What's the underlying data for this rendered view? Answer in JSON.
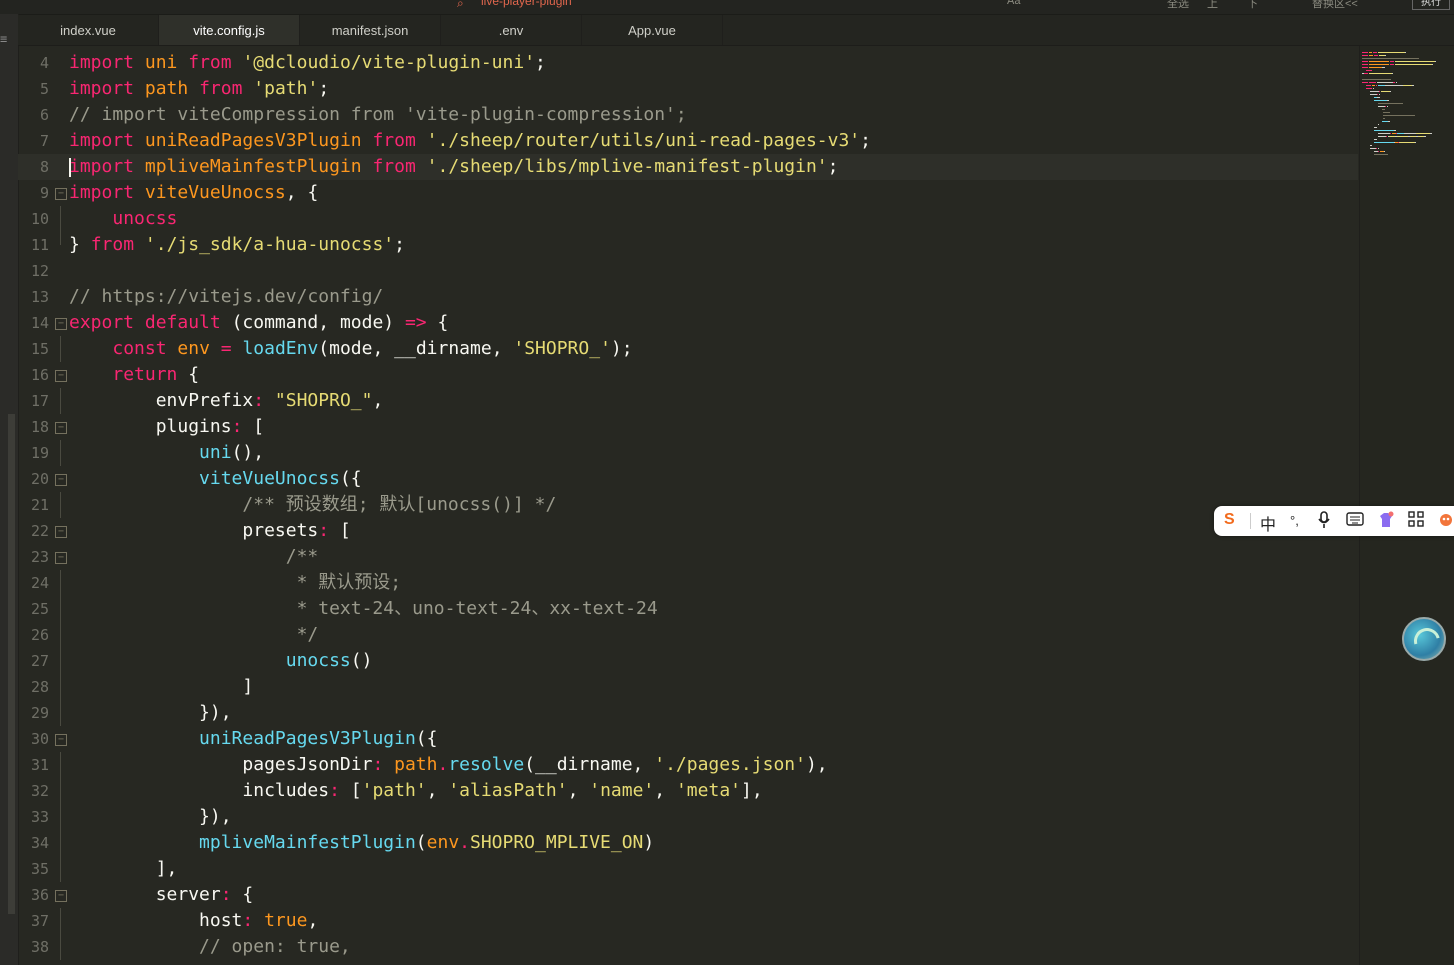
{
  "find_bar": {
    "search_text": "live-player-plugin",
    "controls": [
      "Aa",
      "全选",
      "上",
      "下",
      "替换区<<"
    ],
    "button_label": "执行"
  },
  "tabs": [
    {
      "label": "index.vue",
      "active": false
    },
    {
      "label": "vite.config.js",
      "active": true
    },
    {
      "label": "manifest.json",
      "active": false
    },
    {
      "label": ".env",
      "active": false
    },
    {
      "label": "App.vue",
      "active": false
    }
  ],
  "lines": [
    {
      "n": "4",
      "fold": "",
      "tokens": [
        [
          "kw",
          "import"
        ],
        [
          "pl",
          " "
        ],
        [
          "or",
          "uni"
        ],
        [
          "pl",
          " "
        ],
        [
          "kw",
          "from"
        ],
        [
          "pl",
          " "
        ],
        [
          "st",
          "'@dcloudio/vite-plugin-uni'"
        ],
        [
          "pl",
          ";"
        ]
      ]
    },
    {
      "n": "5",
      "fold": "",
      "tokens": [
        [
          "kw",
          "import"
        ],
        [
          "pl",
          " "
        ],
        [
          "or",
          "path"
        ],
        [
          "pl",
          " "
        ],
        [
          "kw",
          "from"
        ],
        [
          "pl",
          " "
        ],
        [
          "st",
          "'path'"
        ],
        [
          "pl",
          ";"
        ]
      ]
    },
    {
      "n": "6",
      "fold": "",
      "tokens": [
        [
          "cm",
          "// import viteCompression from 'vite-plugin-compression';"
        ]
      ]
    },
    {
      "n": "7",
      "fold": "",
      "tokens": [
        [
          "kw",
          "import"
        ],
        [
          "pl",
          " "
        ],
        [
          "or",
          "uniReadPagesV3Plugin"
        ],
        [
          "pl",
          " "
        ],
        [
          "kw",
          "from"
        ],
        [
          "pl",
          " "
        ],
        [
          "st",
          "'./sheep/router/utils/uni-read-pages-v3'"
        ],
        [
          "pl",
          ";"
        ]
      ]
    },
    {
      "n": "8",
      "fold": "",
      "current": true,
      "tokens": [
        [
          "kw",
          "import"
        ],
        [
          "pl",
          " "
        ],
        [
          "or",
          "mpliveMainfestPlugin"
        ],
        [
          "pl",
          " "
        ],
        [
          "kw",
          "from"
        ],
        [
          "pl",
          " "
        ],
        [
          "st",
          "'./sheep/libs/mplive-manifest-plugin'"
        ],
        [
          "pl",
          ";"
        ]
      ]
    },
    {
      "n": "9",
      "fold": "open",
      "tokens": [
        [
          "kw",
          "import"
        ],
        [
          "pl",
          " "
        ],
        [
          "or",
          "viteVueUnocss"
        ],
        [
          "pl",
          ", {"
        ]
      ]
    },
    {
      "n": "10",
      "fold": "line",
      "tokens": [
        [
          "pl",
          "    "
        ],
        [
          "kw",
          "unocss"
        ]
      ]
    },
    {
      "n": "11",
      "fold": "end",
      "tokens": [
        [
          "pl",
          "} "
        ],
        [
          "kw",
          "from"
        ],
        [
          "pl",
          " "
        ],
        [
          "st",
          "'./js_sdk/a-hua-unocss'"
        ],
        [
          "pl",
          ";"
        ]
      ]
    },
    {
      "n": "12",
      "fold": "",
      "tokens": []
    },
    {
      "n": "13",
      "fold": "",
      "tokens": [
        [
          "cm",
          "// https://vitejs.dev/config/"
        ]
      ]
    },
    {
      "n": "14",
      "fold": "open",
      "tokens": [
        [
          "kw",
          "export"
        ],
        [
          "pl",
          " "
        ],
        [
          "kw",
          "default"
        ],
        [
          "pl",
          " (command, mode) "
        ],
        [
          "kw",
          "=>"
        ],
        [
          "pl",
          " {"
        ]
      ]
    },
    {
      "n": "15",
      "fold": "line",
      "tokens": [
        [
          "pl",
          "    "
        ],
        [
          "kw",
          "const"
        ],
        [
          "pl",
          " "
        ],
        [
          "or",
          "env"
        ],
        [
          "pl",
          " "
        ],
        [
          "kw",
          "="
        ],
        [
          "pl",
          " "
        ],
        [
          "fn",
          "loadEnv"
        ],
        [
          "pl",
          "(mode, __dirname, "
        ],
        [
          "st",
          "'SHOPRO_'"
        ],
        [
          "pl",
          ");"
        ]
      ]
    },
    {
      "n": "16",
      "fold": "open",
      "tokens": [
        [
          "pl",
          "    "
        ],
        [
          "kw",
          "return"
        ],
        [
          "pl",
          " {"
        ]
      ]
    },
    {
      "n": "17",
      "fold": "line",
      "tokens": [
        [
          "pl",
          "        envPrefix"
        ],
        [
          "kw",
          ":"
        ],
        [
          "pl",
          " "
        ],
        [
          "st",
          "\"SHOPRO_\""
        ],
        [
          "pl",
          ","
        ]
      ]
    },
    {
      "n": "18",
      "fold": "open",
      "tokens": [
        [
          "pl",
          "        plugins"
        ],
        [
          "kw",
          ":"
        ],
        [
          "pl",
          " ["
        ]
      ]
    },
    {
      "n": "19",
      "fold": "line",
      "tokens": [
        [
          "pl",
          "            "
        ],
        [
          "fn",
          "uni"
        ],
        [
          "pl",
          "(),"
        ]
      ]
    },
    {
      "n": "20",
      "fold": "open",
      "tokens": [
        [
          "pl",
          "            "
        ],
        [
          "fn",
          "viteVueUnocss"
        ],
        [
          "pl",
          "({"
        ]
      ]
    },
    {
      "n": "21",
      "fold": "line",
      "tokens": [
        [
          "pl",
          "                "
        ],
        [
          "cm",
          "/** 预设数组; 默认[unocss()] */"
        ]
      ]
    },
    {
      "n": "22",
      "fold": "open",
      "tokens": [
        [
          "pl",
          "                presets"
        ],
        [
          "kw",
          ":"
        ],
        [
          "pl",
          " ["
        ]
      ]
    },
    {
      "n": "23",
      "fold": "open",
      "tokens": [
        [
          "pl",
          "                    "
        ],
        [
          "cm",
          "/**"
        ]
      ]
    },
    {
      "n": "24",
      "fold": "line",
      "tokens": [
        [
          "pl",
          "                     "
        ],
        [
          "cm",
          "* 默认预设;"
        ]
      ]
    },
    {
      "n": "25",
      "fold": "line",
      "tokens": [
        [
          "pl",
          "                     "
        ],
        [
          "cm",
          "* text-24、uno-text-24、xx-text-24"
        ]
      ]
    },
    {
      "n": "26",
      "fold": "line",
      "tokens": [
        [
          "pl",
          "                     "
        ],
        [
          "cm",
          "*/"
        ]
      ]
    },
    {
      "n": "27",
      "fold": "line",
      "tokens": [
        [
          "pl",
          "                    "
        ],
        [
          "fn",
          "unocss"
        ],
        [
          "pl",
          "()"
        ]
      ]
    },
    {
      "n": "28",
      "fold": "line",
      "tokens": [
        [
          "pl",
          "                ]"
        ]
      ]
    },
    {
      "n": "29",
      "fold": "line",
      "tokens": [
        [
          "pl",
          "            }),"
        ]
      ]
    },
    {
      "n": "30",
      "fold": "open",
      "tokens": [
        [
          "pl",
          "            "
        ],
        [
          "fn",
          "uniReadPagesV3Plugin"
        ],
        [
          "pl",
          "({"
        ]
      ]
    },
    {
      "n": "31",
      "fold": "line",
      "tokens": [
        [
          "pl",
          "                pagesJsonDir"
        ],
        [
          "kw",
          ":"
        ],
        [
          "pl",
          " "
        ],
        [
          "or",
          "path"
        ],
        [
          "kw",
          "."
        ],
        [
          "fn",
          "resolve"
        ],
        [
          "pl",
          "(__dirname, "
        ],
        [
          "st",
          "'./pages.json'"
        ],
        [
          "pl",
          "),"
        ]
      ]
    },
    {
      "n": "32",
      "fold": "line",
      "tokens": [
        [
          "pl",
          "                includes"
        ],
        [
          "kw",
          ":"
        ],
        [
          "pl",
          " ["
        ],
        [
          "st",
          "'path'"
        ],
        [
          "pl",
          ", "
        ],
        [
          "st",
          "'aliasPath'"
        ],
        [
          "pl",
          ", "
        ],
        [
          "st",
          "'name'"
        ],
        [
          "pl",
          ", "
        ],
        [
          "st",
          "'meta'"
        ],
        [
          "pl",
          "],"
        ]
      ]
    },
    {
      "n": "33",
      "fold": "line",
      "tokens": [
        [
          "pl",
          "            }),"
        ]
      ]
    },
    {
      "n": "34",
      "fold": "line",
      "tokens": [
        [
          "pl",
          "            "
        ],
        [
          "fn",
          "mpliveMainfestPlugin"
        ],
        [
          "pl",
          "("
        ],
        [
          "or",
          "env"
        ],
        [
          "kw",
          "."
        ],
        [
          "st",
          "SHOPRO_MPLIVE_ON"
        ],
        [
          "pl",
          ")"
        ]
      ]
    },
    {
      "n": "35",
      "fold": "line",
      "tokens": [
        [
          "pl",
          "        ],"
        ]
      ]
    },
    {
      "n": "36",
      "fold": "open",
      "tokens": [
        [
          "pl",
          "        server"
        ],
        [
          "kw",
          ":"
        ],
        [
          "pl",
          " {"
        ]
      ]
    },
    {
      "n": "37",
      "fold": "line",
      "tokens": [
        [
          "pl",
          "            host"
        ],
        [
          "kw",
          ":"
        ],
        [
          "pl",
          " "
        ],
        [
          "or",
          "true"
        ],
        [
          "pl",
          ","
        ]
      ]
    },
    {
      "n": "38",
      "fold": "line",
      "tokens": [
        [
          "pl",
          "            "
        ],
        [
          "cm",
          "// open: true,"
        ]
      ]
    }
  ],
  "ime_toolbar": {
    "logo": "S",
    "mode": "中",
    "punct": "°,",
    "items": [
      "mic-icon",
      "keyboard-icon",
      "skin-icon",
      "grid-icon",
      "mascot-icon"
    ]
  },
  "colors": {
    "background": "#272822",
    "keyword": "#f92672",
    "string": "#e6db74",
    "comment": "#9a9a8c",
    "function": "#66d9ef",
    "identifier": "#fd971f"
  }
}
